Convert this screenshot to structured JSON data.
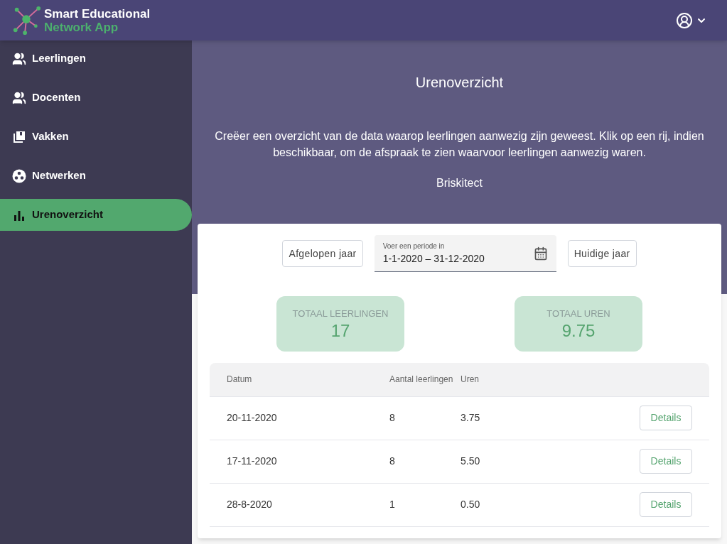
{
  "app": {
    "title_line1": "Smart Educational",
    "title_line2": "Network App"
  },
  "sidebar": {
    "items": [
      {
        "label": "Leerlingen",
        "selected": false
      },
      {
        "label": "Docenten",
        "selected": false
      },
      {
        "label": "Vakken",
        "selected": false
      },
      {
        "label": "Netwerken",
        "selected": false
      },
      {
        "label": "Urenoverzicht",
        "selected": true
      }
    ]
  },
  "page": {
    "title": "Urenoverzicht",
    "description": "Creëer een overzicht van de data waarop leerlingen aanwezig zijn geweest. Klik op een rij, indien beschikbaar, om de afspraak te zien waarvoor leerlingen aanwezig waren.",
    "organisation": "Briskitect"
  },
  "filters": {
    "previous_button": "Afgelopen jaar",
    "period": {
      "label": "Voer een periode in",
      "value": "1-1-2020 – 31-12-2020"
    },
    "current_button": "Huidige jaar"
  },
  "totals": [
    {
      "label": "TOTAAL LEERLINGEN",
      "value": "17"
    },
    {
      "label": "TOTAAL UREN",
      "value": "9.75"
    }
  ],
  "table": {
    "columns": [
      "Datum",
      "Aantal leerlingen",
      "Uren"
    ],
    "rows": [
      {
        "date": "20-11-2020",
        "students": "8",
        "hours": "3.75",
        "action": "Details"
      },
      {
        "date": "17-11-2020",
        "students": "8",
        "hours": "5.50",
        "action": "Details"
      },
      {
        "date": "28-8-2020",
        "students": "1",
        "hours": "0.50",
        "action": "Details"
      }
    ]
  }
}
